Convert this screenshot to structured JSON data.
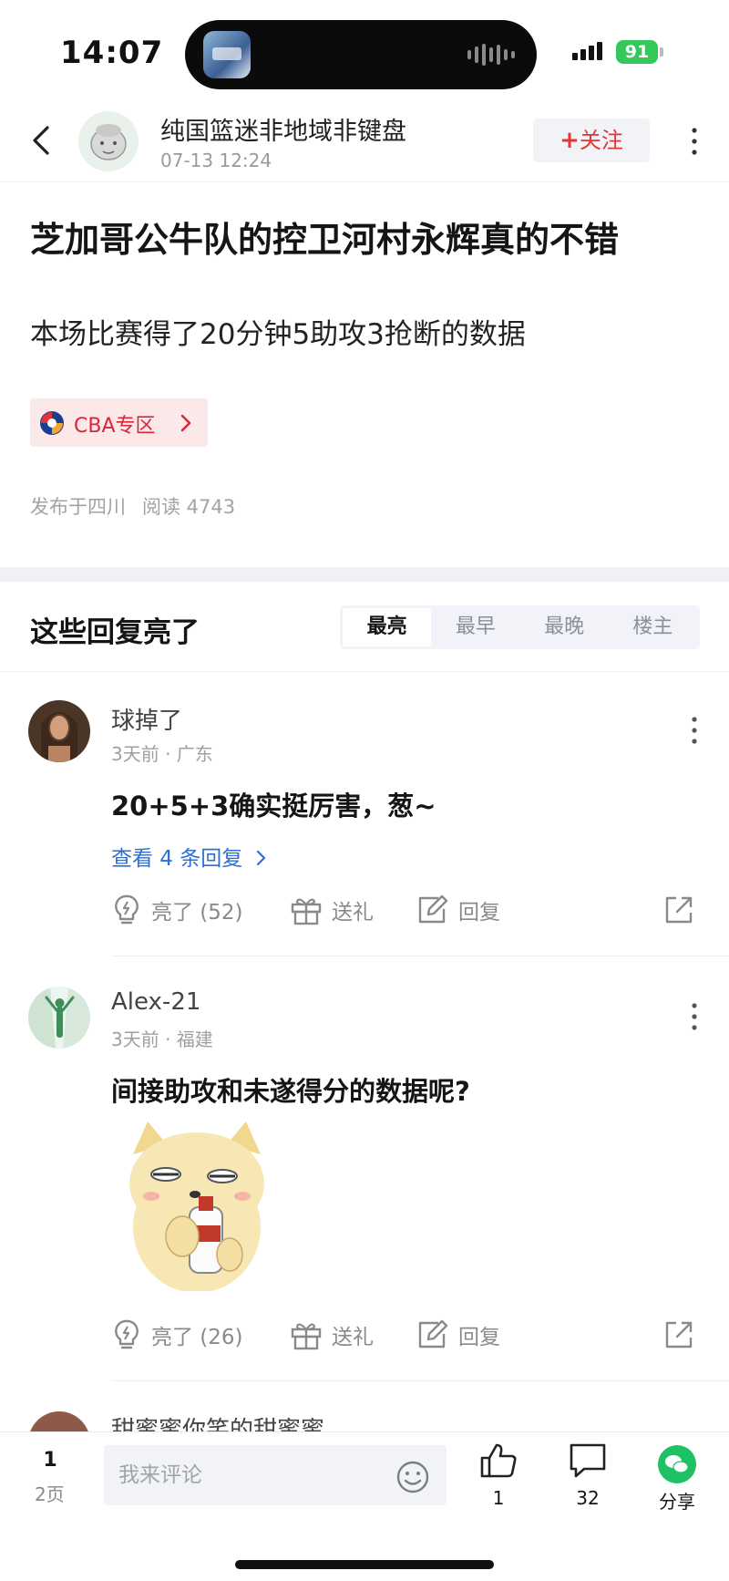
{
  "status_bar": {
    "time": "14:07",
    "battery": "91"
  },
  "header": {
    "author_name": "纯国篮迷非地域非键盘",
    "post_time": "07-13 12:24",
    "follow_plus": "+",
    "follow_label": "关注"
  },
  "article": {
    "title": "芝加哥公牛队的控卫河村永辉真的不错",
    "body": "本场比赛得了20分钟5助攻3抢断的数据",
    "tag_label": "CBA专区",
    "location": "发布于四川",
    "read_label": "阅读 4743"
  },
  "replies": {
    "title": "这些回复亮了",
    "sort_tabs": [
      "最亮",
      "最早",
      "最晚",
      "楼主"
    ],
    "active_tab": "最亮"
  },
  "comments": [
    {
      "name": "球掉了",
      "meta": "3天前 · 广东",
      "text": "20+5+3确实挺厉害，葱~",
      "view_replies": "查看 4 条回复",
      "like_label": "亮了 (52)",
      "gift_label": "送礼",
      "reply_label": "回复"
    },
    {
      "name": "Alex-21",
      "meta": "3天前 · 福建",
      "text": "间接助攻和未遂得分的数据呢?",
      "like_label": "亮了 (26)",
      "gift_label": "送礼",
      "reply_label": "回复"
    },
    {
      "name": "甜蜜蜜你笑的甜蜜蜜"
    }
  ],
  "bottom_bar": {
    "page_current": "1",
    "page_total": "2页",
    "input_placeholder": "我来评论",
    "like_count": "1",
    "comment_count": "32",
    "share_label": "分享"
  },
  "colors": {
    "accent_red": "#e03636",
    "link_blue": "#2d6fd3",
    "share_green": "#1ec264",
    "battery_green": "#34c759"
  },
  "icons": [
    "back-icon",
    "more-icon",
    "cba-logo-icon",
    "chevron-right-icon",
    "lightbulb-icon",
    "gift-icon",
    "edit-icon",
    "share-out-icon",
    "emoji-icon",
    "thumb-up-icon",
    "comment-icon",
    "wechat-icon"
  ]
}
